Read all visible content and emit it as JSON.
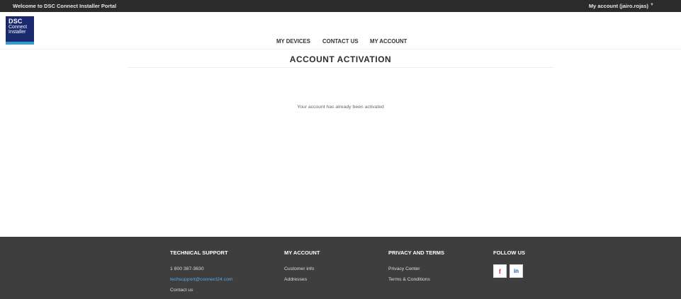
{
  "topbar": {
    "welcome": "Welcome to DSC Connect Installer Portal",
    "account": "My account (jairo.rojas)"
  },
  "logo": {
    "line1": "DSC",
    "line2": "Connect",
    "line3": "Installer"
  },
  "nav": {
    "items": [
      "MY DEVICES",
      "CONTACT US",
      "MY ACCOUNT"
    ]
  },
  "main": {
    "title": "ACCOUNT ACTIVATION",
    "message": "Your account has already been activated"
  },
  "footer": {
    "technical_support": {
      "heading": "TECHNICAL SUPPORT",
      "phone": "1 800 387-3630",
      "email": "techsupport@connect24.com",
      "contact": "Contact us"
    },
    "my_account": {
      "heading": "MY ACCOUNT",
      "links": [
        "Customer info",
        "Addresses"
      ]
    },
    "privacy": {
      "heading": "PRIVACY AND TERMS",
      "links": [
        "Privacy Center",
        "Terms & Conditions"
      ]
    },
    "follow": {
      "heading": "FOLLOW US",
      "facebook": "f",
      "linkedin": "in"
    }
  },
  "colors": {
    "topbar": "#2b2b2b",
    "footer": "#3e3e3e",
    "logo_bg": "#1b2a6e",
    "link_blue": "#5aa8e6"
  }
}
